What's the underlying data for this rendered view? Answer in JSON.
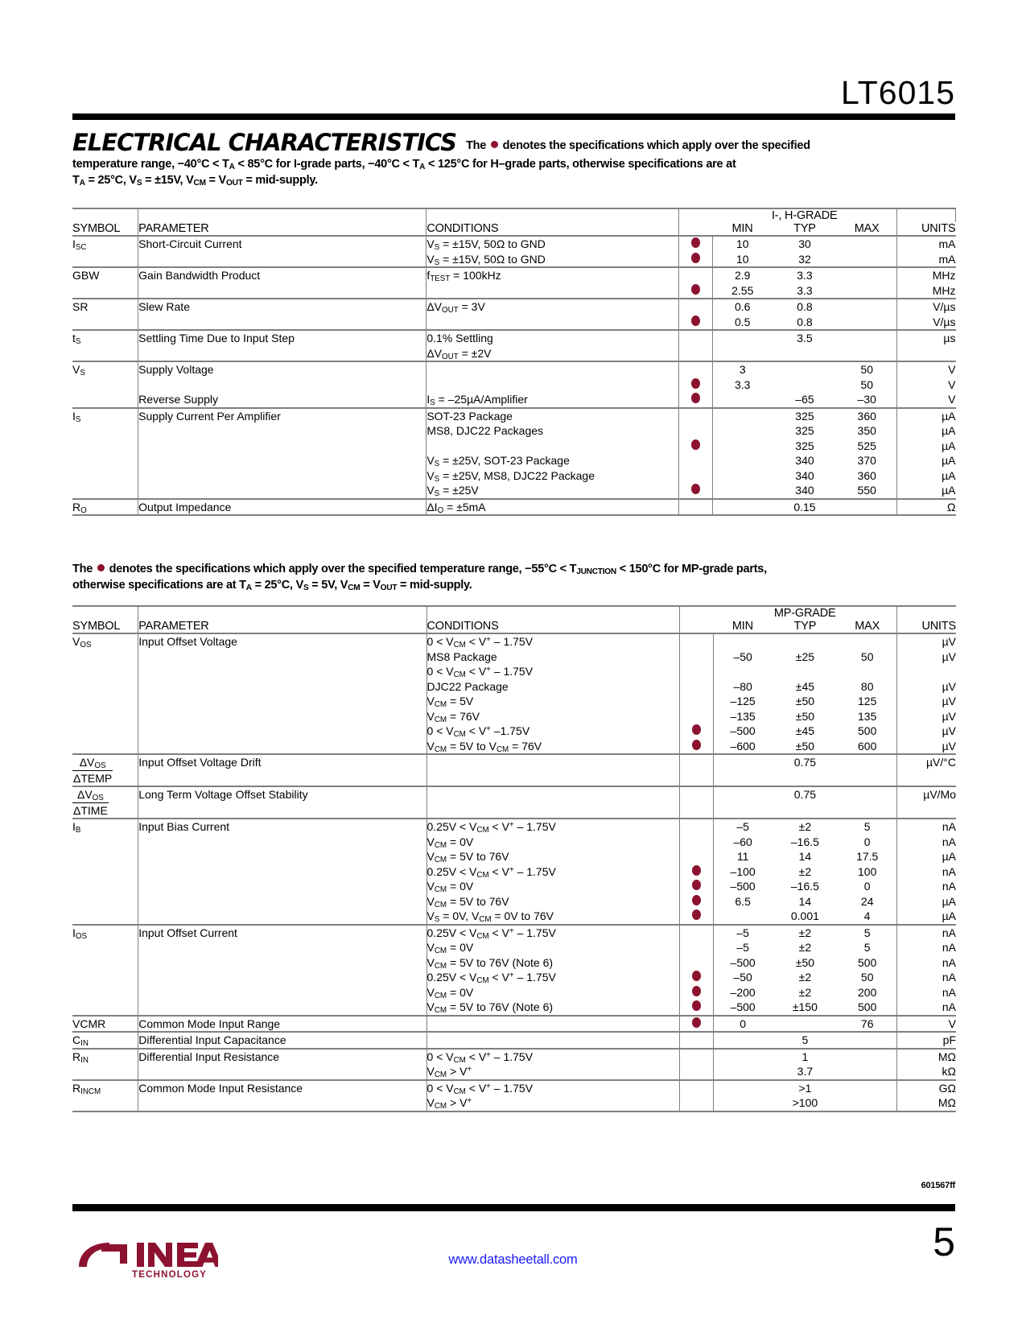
{
  "header": {
    "part_number": "LT6015",
    "section_title": "ELECTRICAL CHARACTERISTICS",
    "note_line1": "The ● denotes the specifications which apply over the specified",
    "note_line2_pre": "temperature range, –40°C < T",
    "note_line2": "temperature range, –40°C < TA < 85°C for I-grade parts, –40°C < TA < 125°C for H–grade parts, otherwise specifications are at",
    "note_line3": "TA = 25°C, VS = ±15V, VCM = VOUT = mid-supply."
  },
  "mid_note": {
    "line1": "The ● denotes the specifications which apply over the specified temperature range, –55°C < TJUNCTION < 150°C for MP-grade parts,",
    "line2": "otherwise specifications are at TA = 25°C, VS = 5V, VCM = VOUT = mid-supply."
  },
  "columns": {
    "symbol": "SYMBOL",
    "parameter": "PARAMETER",
    "conditions": "CONDITIONS",
    "min": "MIN",
    "typ": "TYP",
    "max": "MAX",
    "units": "UNITS"
  },
  "table1": {
    "grade": "I-, H-GRADE",
    "rows": [
      {
        "symbol": "ISC",
        "parameter": "Short-Circuit Current",
        "conditions": [
          "VS = ±15V, 50Ω to GND",
          "VS = ±15V, 50Ω to GND"
        ],
        "bullets": [
          true,
          true
        ],
        "min": [
          "10",
          "10"
        ],
        "typ": [
          "30",
          "32"
        ],
        "max": [
          "",
          ""
        ],
        "units": [
          "mA",
          "mA"
        ]
      },
      {
        "symbol": "GBW",
        "parameter": "Gain Bandwidth Product",
        "conditions": [
          "fTEST = 100kHz",
          ""
        ],
        "bullets": [
          false,
          true
        ],
        "min": [
          "2.9",
          "2.55"
        ],
        "typ": [
          "3.3",
          "3.3"
        ],
        "max": [
          "",
          ""
        ],
        "units": [
          "MHz",
          "MHz"
        ]
      },
      {
        "symbol": "SR",
        "parameter": "Slew Rate",
        "conditions": [
          "ΔVOUT = 3V",
          ""
        ],
        "bullets": [
          false,
          true
        ],
        "min": [
          "0.6",
          "0.5"
        ],
        "typ": [
          "0.8",
          "0.8"
        ],
        "max": [
          "",
          ""
        ],
        "units": [
          "V/µs",
          "V/µs"
        ]
      },
      {
        "symbol": "tS",
        "parameter": "Settling Time Due to Input Step",
        "conditions": [
          "0.1% Settling",
          "ΔVOUT = ±2V"
        ],
        "bullets": [
          false,
          false
        ],
        "min": [
          "",
          ""
        ],
        "typ": [
          "3.5",
          ""
        ],
        "max": [
          "",
          ""
        ],
        "units": [
          "µs",
          ""
        ]
      },
      {
        "symbol": "VS",
        "parameter": "Supply Voltage",
        "parameter2": "Reverse Supply",
        "conditions": [
          "",
          "",
          "IS = –25µA/Amplifier"
        ],
        "bullets": [
          false,
          true,
          true
        ],
        "min": [
          "3",
          "3.3",
          ""
        ],
        "typ": [
          "",
          "",
          "–65"
        ],
        "max": [
          "50",
          "50",
          "–30"
        ],
        "units": [
          "V",
          "V",
          "V"
        ]
      },
      {
        "symbol": "IS",
        "parameter": "Supply Current Per Amplifier",
        "conditions": [
          "SOT-23 Package",
          "MS8, DJC22 Packages",
          "",
          "VS = ±25V, SOT-23 Package",
          "VS = ±25V, MS8, DJC22 Package",
          "VS = ±25V"
        ],
        "bullets": [
          false,
          false,
          true,
          false,
          false,
          true
        ],
        "min": [
          "",
          "",
          "",
          "",
          "",
          ""
        ],
        "typ": [
          "325",
          "325",
          "325",
          "340",
          "340",
          "340"
        ],
        "max": [
          "360",
          "350",
          "525",
          "370",
          "360",
          "550"
        ],
        "units": [
          "µA",
          "µA",
          "µA",
          "µA",
          "µA",
          "µA"
        ]
      },
      {
        "symbol": "RO",
        "parameter": "Output Impedance",
        "conditions": [
          "ΔIO = ±5mA"
        ],
        "bullets": [
          false
        ],
        "min": [
          ""
        ],
        "typ": [
          "0.15"
        ],
        "max": [
          ""
        ],
        "units": [
          "Ω"
        ]
      }
    ]
  },
  "table2": {
    "grade": "MP-GRADE",
    "rows": [
      {
        "symbol": "VOS",
        "parameter": "Input Offset Voltage",
        "conditions": [
          "0 < VCM < V+ – 1.75V",
          "MS8 Package",
          "0 < VCM < V+ – 1.75V",
          "DJC22 Package",
          "VCM = 5V",
          "VCM = 76V",
          "0 < VCM < V+ –1.75V",
          "VCM = 5V to VCM = 76V"
        ],
        "bullets": [
          false,
          false,
          false,
          false,
          false,
          false,
          true,
          true
        ],
        "min": [
          "",
          "–50",
          "",
          "–80",
          "–125",
          "–135",
          "–500",
          "–600"
        ],
        "typ": [
          "",
          "±25",
          "",
          "±45",
          "±50",
          "±50",
          "±45",
          "±50"
        ],
        "max": [
          "",
          "50",
          "",
          "80",
          "125",
          "135",
          "500",
          "600"
        ],
        "units": [
          "µV",
          "µV",
          "",
          "µV",
          "µV",
          "µV",
          "µV",
          "µV"
        ]
      },
      {
        "symbol_frac": [
          "ΔVOS",
          "ΔTEMP"
        ],
        "parameter": "Input Offset Voltage Drift",
        "conditions": [
          ""
        ],
        "bullets": [
          false
        ],
        "min": [
          ""
        ],
        "typ": [
          "0.75"
        ],
        "max": [
          ""
        ],
        "units": [
          "µV/°C"
        ]
      },
      {
        "symbol_frac": [
          "ΔVOS",
          "ΔTIME"
        ],
        "parameter": "Long Term Voltage Offset Stability",
        "conditions": [
          ""
        ],
        "bullets": [
          false
        ],
        "min": [
          ""
        ],
        "typ": [
          "0.75"
        ],
        "max": [
          ""
        ],
        "units": [
          "µV/Mo"
        ]
      },
      {
        "symbol": "IB",
        "parameter": "Input Bias Current",
        "conditions": [
          "0.25V < VCM < V+ – 1.75V",
          "VCM = 0V",
          "VCM = 5V to 76V",
          "0.25V < VCM < V+ – 1.75V",
          "VCM = 0V",
          "VCM = 5V to 76V",
          "VS = 0V, VCM = 0V to 76V"
        ],
        "bullets": [
          false,
          false,
          false,
          true,
          true,
          true,
          true
        ],
        "min": [
          "–5",
          "–60",
          "11",
          "–100",
          "–500",
          "6.5",
          ""
        ],
        "typ": [
          "±2",
          "–16.5",
          "14",
          "±2",
          "–16.5",
          "14",
          "0.001"
        ],
        "max": [
          "5",
          "0",
          "17.5",
          "100",
          "0",
          "24",
          "4"
        ],
        "units": [
          "nA",
          "nA",
          "µA",
          "nA",
          "nA",
          "µA",
          "µA"
        ]
      },
      {
        "symbol": "IOS",
        "parameter": "Input Offset Current",
        "conditions": [
          "0.25V < VCM < V+ – 1.75V",
          "VCM = 0V",
          "VCM = 5V to 76V (Note 6)",
          "0.25V < VCM < V+ – 1.75V",
          "VCM = 0V",
          "VCM = 5V to 76V (Note 6)"
        ],
        "bullets": [
          false,
          false,
          false,
          true,
          true,
          true
        ],
        "min": [
          "–5",
          "–5",
          "–500",
          "–50",
          "–200",
          "–500"
        ],
        "typ": [
          "±2",
          "±2",
          "±50",
          "±2",
          "±2",
          "±150"
        ],
        "max": [
          "5",
          "5",
          "500",
          "50",
          "200",
          "500"
        ],
        "units": [
          "nA",
          "nA",
          "nA",
          "nA",
          "nA",
          "nA"
        ]
      },
      {
        "symbol": "VCMR",
        "parameter": "Common Mode Input Range",
        "conditions": [
          ""
        ],
        "bullets": [
          true
        ],
        "min": [
          "0"
        ],
        "typ": [
          ""
        ],
        "max": [
          "76"
        ],
        "units": [
          "V"
        ]
      },
      {
        "symbol": "CIN",
        "parameter": "Differential Input Capacitance",
        "conditions": [
          ""
        ],
        "bullets": [
          false
        ],
        "min": [
          ""
        ],
        "typ": [
          "5"
        ],
        "max": [
          ""
        ],
        "units": [
          "pF"
        ]
      },
      {
        "symbol": "RIN",
        "parameter": "Differential Input Resistance",
        "conditions": [
          "0 < VCM < V+ – 1.75V",
          "VCM > V+"
        ],
        "bullets": [
          false,
          false
        ],
        "min": [
          "",
          ""
        ],
        "typ": [
          "1",
          "3.7"
        ],
        "max": [
          "",
          ""
        ],
        "units": [
          "MΩ",
          "kΩ"
        ]
      },
      {
        "symbol": "RINCM",
        "parameter": "Common Mode Input Resistance",
        "conditions": [
          "0 < VCM < V+ – 1.75V",
          "VCM > V+"
        ],
        "bullets": [
          false,
          false
        ],
        "min": [
          "",
          ""
        ],
        "typ": [
          ">1",
          ">100"
        ],
        "max": [
          "",
          ""
        ],
        "units": [
          "GΩ",
          "MΩ"
        ]
      }
    ]
  },
  "footer": {
    "doc_id": "601567ff",
    "url": "www.datasheetall.com",
    "page_number": "5",
    "logo_name": "LINEAR",
    "logo_sub": "TECHNOLOGY"
  },
  "colors": {
    "bullet": "#8c1230",
    "link": "#1a1aff",
    "rule": "#000000",
    "grid": "#808080"
  }
}
